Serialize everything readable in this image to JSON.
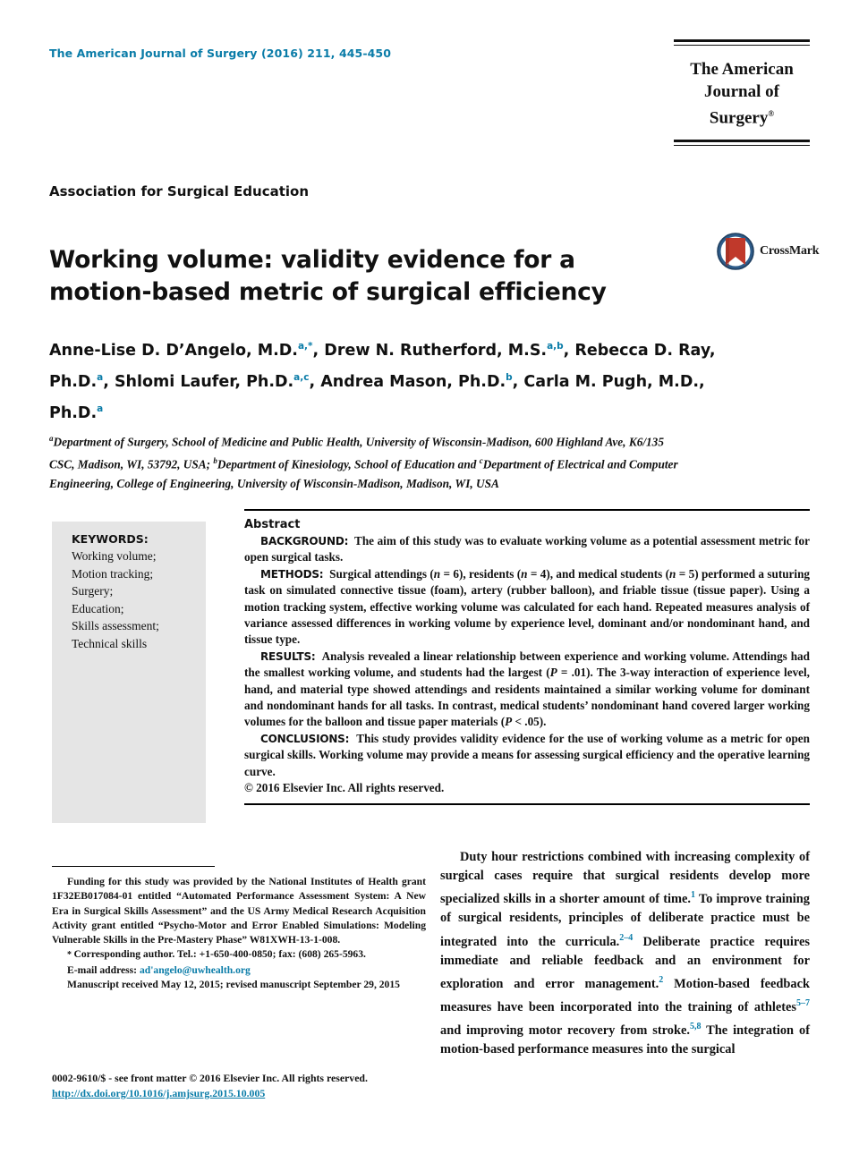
{
  "masthead": {
    "journal_line": "The American Journal of Surgery (2016) 211, 445-450",
    "logo_line1": "The American",
    "logo_line2": "Journal of Surgery",
    "logo_trademark": "®",
    "accent_color": "#0a7ca8"
  },
  "article": {
    "section_label": "Association for Surgical Education",
    "title": "Working volume: validity evidence for a motion-based metric of surgical efficiency",
    "crossmark_label": "CrossMark",
    "crossmark_ring_color": "#2e5c8a",
    "crossmark_ribbon_color": "#c0392b"
  },
  "authors": {
    "list": [
      {
        "name": "Anne-Lise D. D’Angelo, M.D.",
        "marks": "a,*",
        "sep": ", "
      },
      {
        "name": "Drew N. Rutherford, M.S.",
        "marks": "a,b",
        "sep": ", "
      },
      {
        "name": "Rebecca D. Ray, Ph.D.",
        "marks": "a",
        "sep": ", "
      },
      {
        "name": "Shlomi Laufer, Ph.D.",
        "marks": "a,c",
        "sep": ", "
      },
      {
        "name": "Andrea Mason, Ph.D.",
        "marks": "b",
        "sep": ", "
      },
      {
        "name": "Carla M. Pugh, M.D., Ph.D.",
        "marks": "a",
        "sep": ""
      }
    ]
  },
  "affiliations": {
    "text_parts": [
      {
        "sup": "a",
        "text": "Department of Surgery, School of Medicine and Public Health, University of Wisconsin-Madison, 600 Highland Ave, K6/135 CSC, Madison, WI, 53792, USA; "
      },
      {
        "sup": "b",
        "text": "Department of Kinesiology, School of Education and "
      },
      {
        "sup": "c",
        "text": "Department of Electrical and Computer Engineering, College of Engineering, University of Wisconsin-Madison, Madison, WI, USA"
      }
    ]
  },
  "keywords": {
    "title": "KEYWORDS:",
    "items": [
      "Working volume;",
      "Motion tracking;",
      "Surgery;",
      "Education;",
      "Skills assessment;",
      "Technical skills"
    ]
  },
  "abstract": {
    "heading": "Abstract",
    "sections": [
      {
        "label": "BACKGROUND:",
        "text": "The aim of this study was to evaluate working volume as a potential assessment metric for open surgical tasks."
      },
      {
        "label": "METHODS:",
        "text": "Surgical attendings (n = 6), residents (n = 4), and medical students (n = 5) performed a suturing task on simulated connective tissue (foam), artery (rubber balloon), and friable tissue (tissue paper). Using a motion tracking system, effective working volume was calculated for each hand. Repeated measures analysis of variance assessed differences in working volume by experience level, dominant and/or nondominant hand, and tissue type."
      },
      {
        "label": "RESULTS:",
        "text": "Analysis revealed a linear relationship between experience and working volume. Attendings had the smallest working volume, and students had the largest (P = .01). The 3-way interaction of experience level, hand, and material type showed attendings and residents maintained a similar working volume for dominant and nondominant hands for all tasks. In contrast, medical students’ nondominant hand covered larger working volumes for the balloon and tissue paper materials (P < .05)."
      },
      {
        "label": "CONCLUSIONS:",
        "text": "This study provides validity evidence for the use of working volume as a metric for open surgical skills. Working volume may provide a means for assessing surgical efficiency and the operative learning curve."
      }
    ],
    "copyright": "© 2016 Elsevier Inc. All rights reserved."
  },
  "footnotes": {
    "funding": "Funding for this study was provided by the National Institutes of Health grant 1F32EB017084-01 entitled “Automated Performance Assessment System: A New Era in Surgical Skills Assessment” and the US Army Medical Research Acquisition Activity grant entitled “Psycho-Motor and Error Enabled Simulations: Modeling Vulnerable Skills in the Pre-Mastery Phase” W81XWH-13-1-008.",
    "corresponding": "Corresponding author. Tel.: +1-650-400-0850; fax: (608) 265-5963.",
    "email_label": "E-mail address:",
    "email": "ad'angelo@uwhealth.org",
    "manuscript": "Manuscript received May 12, 2015; revised manuscript September 29, 2015"
  },
  "body": {
    "intro_parts": [
      {
        "text": "Duty hour restrictions combined with increasing complexity of surgical cases require that surgical residents develop more specialized skills in a shorter amount of time.",
        "sup": "1"
      },
      {
        "text": " To improve training of surgical residents, principles of deliberate practice must be integrated into the curricula.",
        "sup": "2–4"
      },
      {
        "text": " Deliberate practice requires immediate and reliable feedback and an environment for exploration and error management.",
        "sup": "2"
      },
      {
        "text": " Motion-based feedback measures have been incorporated into the training of athletes",
        "sup": "5–7"
      },
      {
        "text": " and improving motor recovery from stroke.",
        "sup": "5,8"
      },
      {
        "text": " The integration of motion-based performance measures into the surgical",
        "sup": ""
      }
    ]
  },
  "footer": {
    "issn_line": "0002-9610/$ - see front matter © 2016 Elsevier Inc. All rights reserved.",
    "doi_line": "http://dx.doi.org/10.1016/j.amjsurg.2015.10.005"
  }
}
